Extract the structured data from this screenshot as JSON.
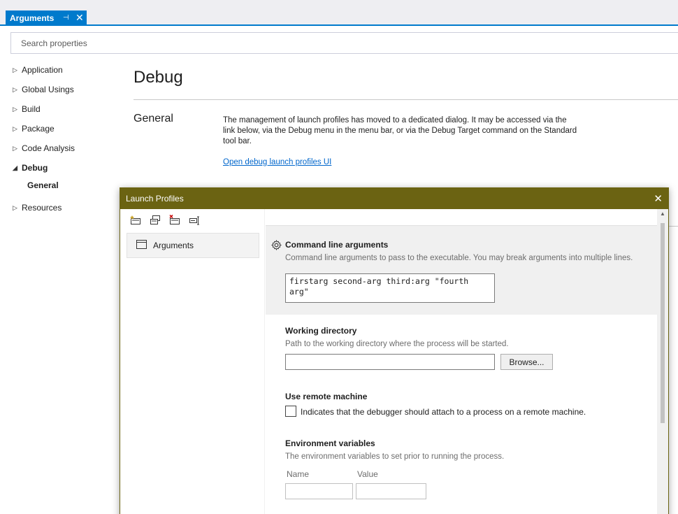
{
  "tab": {
    "title": "Arguments",
    "pin_icon": "pin-icon",
    "close_icon": "close-icon"
  },
  "search": {
    "placeholder": "Search properties"
  },
  "nav": {
    "items": [
      {
        "label": "Application",
        "arrow": "▷"
      },
      {
        "label": "Global Usings",
        "arrow": "▷"
      },
      {
        "label": "Build",
        "arrow": "▷"
      },
      {
        "label": "Package",
        "arrow": "▷"
      },
      {
        "label": "Code Analysis",
        "arrow": "▷"
      },
      {
        "label": "Debug",
        "arrow": "◢"
      },
      {
        "label": "General",
        "arrow": ""
      },
      {
        "label": "Resources",
        "arrow": "▷"
      }
    ]
  },
  "main": {
    "title": "Debug",
    "section": "General",
    "description": "The management of launch profiles has moved to a dedicated dialog. It may be accessed via the link below, via the Debug menu in the menu bar, or via the Debug Target command on the Standard tool bar.",
    "link": "Open debug launch profiles UI"
  },
  "dialog": {
    "title": "Launch Profiles",
    "close": "✕",
    "profiles": [
      "Arguments"
    ],
    "command_line": {
      "title": "Command line arguments",
      "description": "Command line arguments to pass to the executable. You may break arguments into multiple lines.",
      "value": "firstarg second-arg third:arg \"fourth\narg\""
    },
    "working_directory": {
      "title": "Working directory",
      "description": "Path to the working directory where the process will be started.",
      "value": "",
      "browse_label": "Browse..."
    },
    "remote_machine": {
      "title": "Use remote machine",
      "checkbox_label": "Indicates that the debugger should attach to a process on a remote machine.",
      "checked": false
    },
    "environment": {
      "title": "Environment variables",
      "description": "The environment variables to set prior to running the process.",
      "name_header": "Name",
      "value_header": "Value"
    }
  },
  "colors": {
    "accent": "#007acc",
    "dialog_title": "#6b6312",
    "link": "#0066cc"
  }
}
